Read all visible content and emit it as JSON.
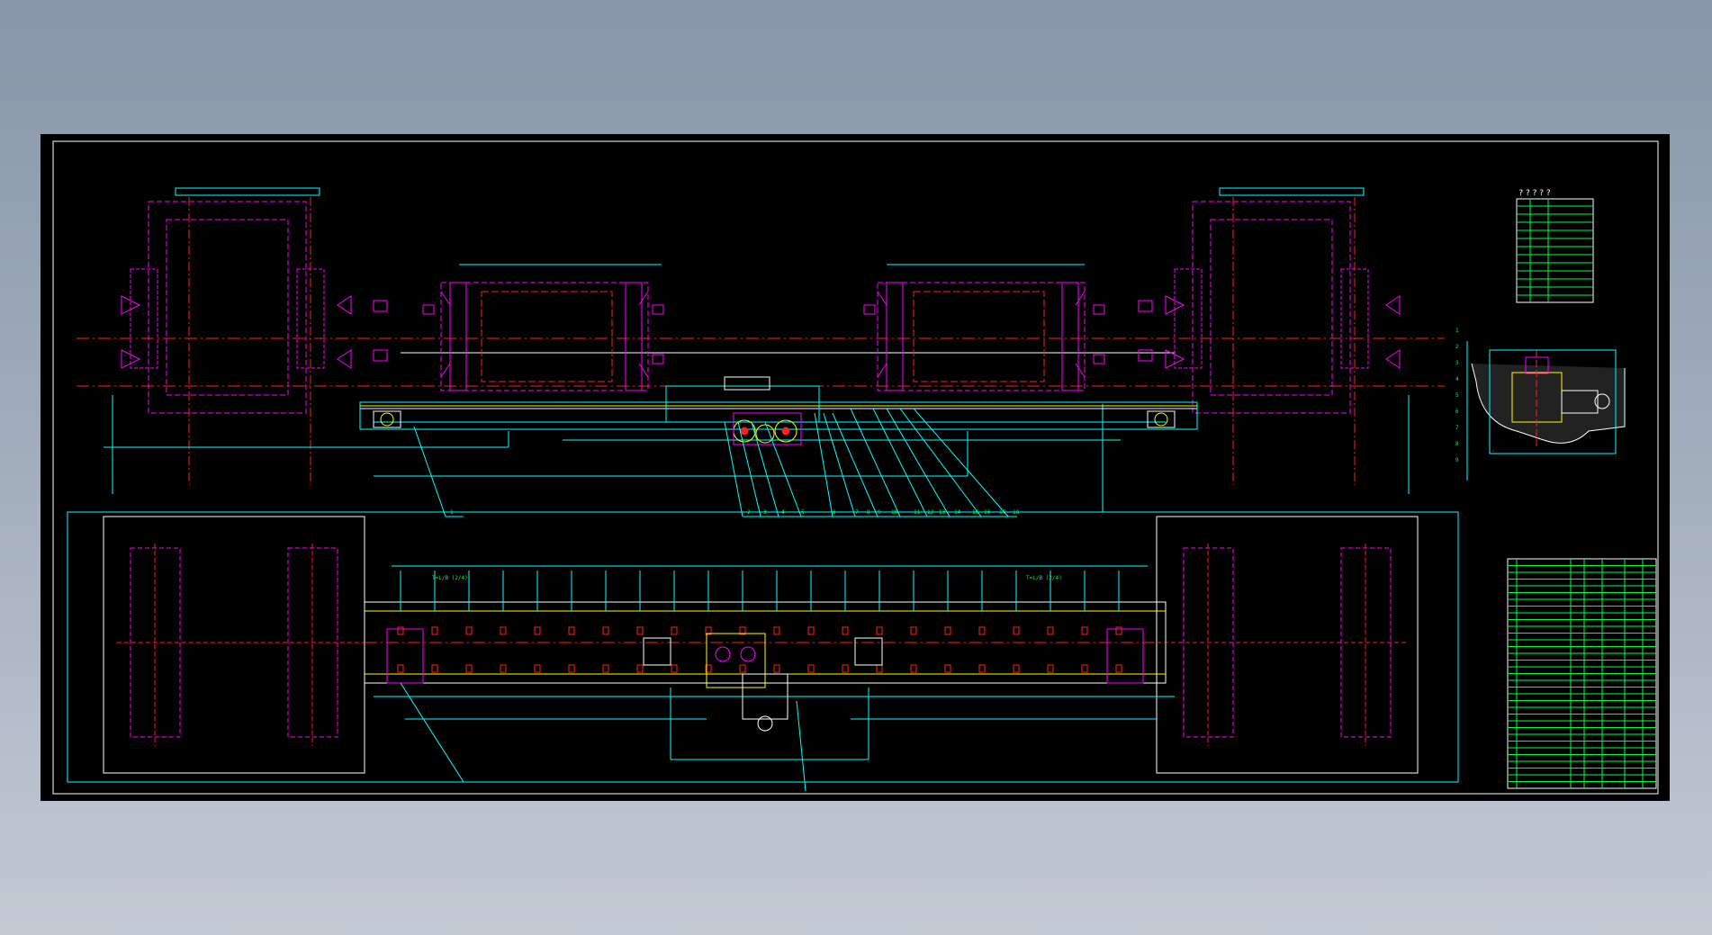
{
  "colors": {
    "background": "#8f9cb0",
    "sheet": "#000000",
    "frame": "#ffffff",
    "magenta": "#ff00ff",
    "red": "#ff2020",
    "cyan": "#00ffff",
    "green": "#00ff40",
    "yellow": "#ffff00"
  },
  "legend": {
    "title": "? ? ? ? ?"
  },
  "callouts": [
    "1",
    "2",
    "3",
    "4",
    "5",
    "6",
    "7",
    "8",
    "9",
    "10",
    "11",
    "12",
    "13",
    "14",
    "15",
    "16",
    "17",
    "18"
  ],
  "side_callouts": [
    "1",
    "2",
    "3",
    "4",
    "5",
    "6",
    "7",
    "8",
    "9"
  ],
  "plan_notes": [
    "T=L/B (2/4)",
    "T=L/B (2/4)"
  ]
}
